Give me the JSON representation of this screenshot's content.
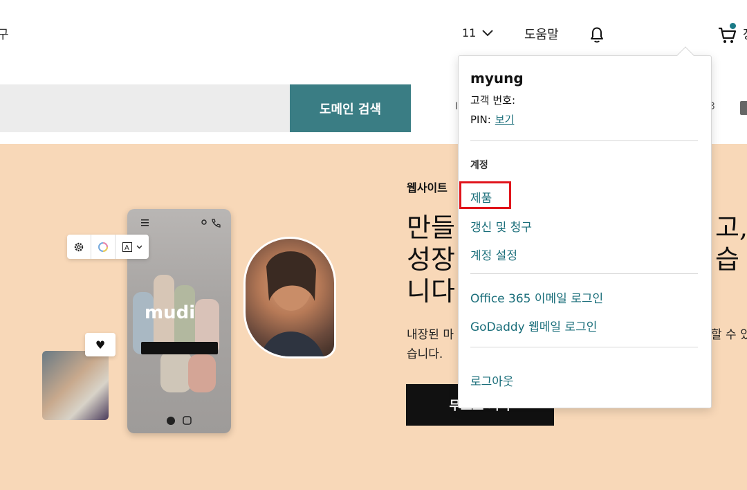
{
  "header": {
    "left_partial": "구",
    "language": "11",
    "help": "도움말",
    "cart_partial": "장"
  },
  "search": {
    "placeholder": "",
    "button": "도메인 검색",
    "partial_left": "I",
    "partial_right": "3"
  },
  "hero": {
    "kicker": "웹사이트",
    "title_lines": [
      "만들고,",
      "성장하세요. 습",
      "니다"
    ],
    "title_visible_1": "만들",
    "title_visible_1_end": "고,",
    "title_visible_2": "성장",
    "title_visible_2_end": "습",
    "title_visible_3": "니다",
    "desc_1": "내장된 마",
    "desc_1_end": "할 수 있",
    "desc_2": "습니다.",
    "cta": "무료로 시작"
  },
  "illustration": {
    "heart": "♥"
  },
  "dropdown": {
    "username": "myung",
    "customer_no_label": "고객 번호:",
    "pin_label": "PIN:",
    "pin_link": "보기",
    "section_label": "계정",
    "items": [
      "제품",
      "갱신 및 청구",
      "계정 설정"
    ],
    "email_items": [
      "Office 365 이메일 로그인",
      "GoDaddy 웹메일 로그인"
    ],
    "logout": "로그아웃"
  },
  "colors": {
    "accent_teal": "#3a7d84",
    "link_teal": "#1a6e7a",
    "hero_bg": "#f8d8b8",
    "highlight_red": "#e0141b"
  }
}
